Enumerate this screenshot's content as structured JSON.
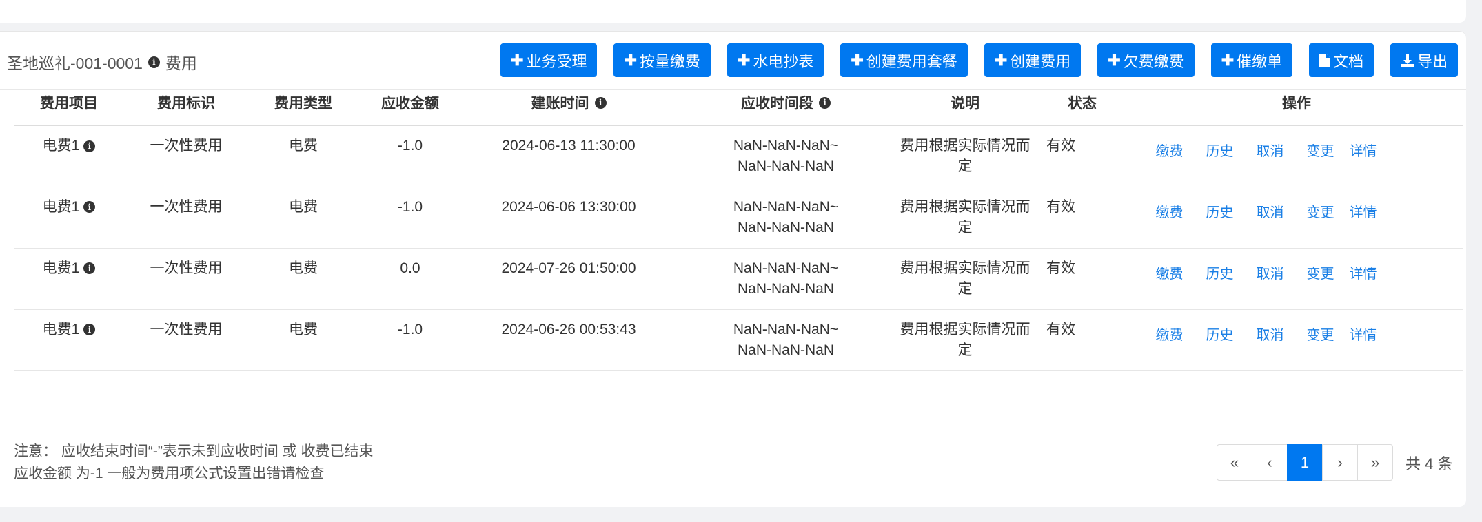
{
  "header": {
    "title": "圣地巡礼-001-0001",
    "suffix": "费用"
  },
  "toolbar": {
    "buttons": [
      {
        "label": "业务受理",
        "icon": "plus"
      },
      {
        "label": "按量缴费",
        "icon": "plus"
      },
      {
        "label": "水电抄表",
        "icon": "plus"
      },
      {
        "label": "创建费用套餐",
        "icon": "plus"
      },
      {
        "label": "创建费用",
        "icon": "plus"
      },
      {
        "label": "欠费缴费",
        "icon": "plus"
      },
      {
        "label": "催缴单",
        "icon": "plus"
      },
      {
        "label": "文档",
        "icon": "file-icon"
      },
      {
        "label": "导出",
        "icon": "download-icon"
      }
    ]
  },
  "table": {
    "columns": [
      "费用项目",
      "费用标识",
      "费用类型",
      "应收金额",
      "建账时间",
      "应收时间段",
      "说明",
      "状态",
      "操作"
    ],
    "rows": [
      {
        "item": "电费1",
        "flag": "一次性费用",
        "type": "电费",
        "amount": "-1.0",
        "created": "2024-06-13 11:30:00",
        "period_start": "NaN-NaN-NaN~",
        "period_end": "NaN-NaN-NaN",
        "note": "费用根据实际情况而定",
        "status": "有效"
      },
      {
        "item": "电费1",
        "flag": "一次性费用",
        "type": "电费",
        "amount": "-1.0",
        "created": "2024-06-06 13:30:00",
        "period_start": "NaN-NaN-NaN~",
        "period_end": "NaN-NaN-NaN",
        "note": "费用根据实际情况而定",
        "status": "有效"
      },
      {
        "item": "电费1",
        "flag": "一次性费用",
        "type": "电费",
        "amount": "0.0",
        "created": "2024-07-26 01:50:00",
        "period_start": "NaN-NaN-NaN~",
        "period_end": "NaN-NaN-NaN",
        "note": "费用根据实际情况而定",
        "status": "有效"
      },
      {
        "item": "电费1",
        "flag": "一次性费用",
        "type": "电费",
        "amount": "-1.0",
        "created": "2024-06-26 00:53:43",
        "period_start": "NaN-NaN-NaN~",
        "period_end": "NaN-NaN-NaN",
        "note": "费用根据实际情况而定",
        "status": "有效"
      }
    ],
    "actions": [
      "缴费",
      "历史",
      "取消",
      "变更",
      "详情"
    ]
  },
  "notes": {
    "line1": "注意： 应收结束时间“-”表示未到应收时间 或 收费已结束",
    "line2": "应收金额 为-1 一般为费用项公式设置出错请检查"
  },
  "pagination": {
    "first": "«",
    "prev": "‹",
    "current": "1",
    "next": "›",
    "last": "»",
    "total": "共 4 条"
  },
  "colors": {
    "primary": "#0078f0",
    "link": "#1a7fe6",
    "background": "#f1f2f4"
  }
}
